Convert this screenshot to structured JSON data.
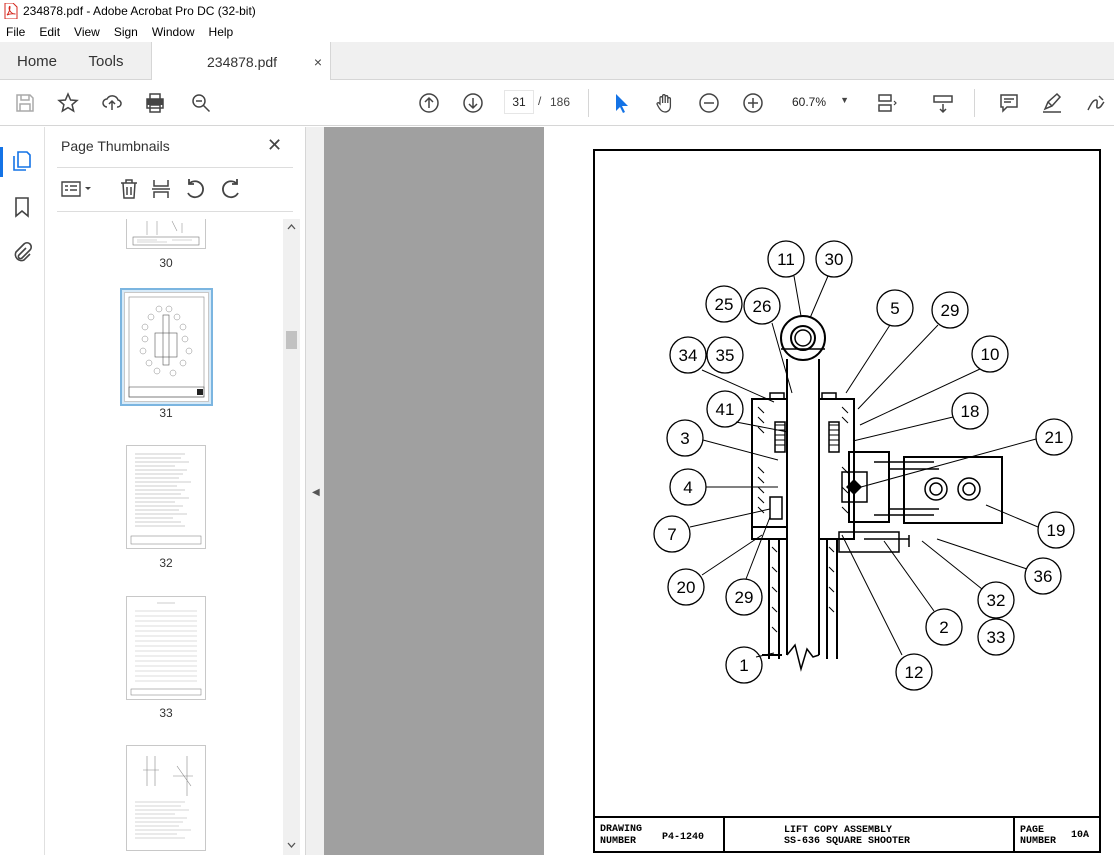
{
  "window": {
    "title": "234878.pdf - Adobe Acrobat Pro DC (32-bit)"
  },
  "menu": [
    "File",
    "Edit",
    "View",
    "Sign",
    "Window",
    "Help"
  ],
  "tabs": {
    "home": "Home",
    "tools": "Tools",
    "document": "234878.pdf",
    "close": "×"
  },
  "toolbar": {
    "current_page": "31",
    "page_separator": "/",
    "total_pages": "186",
    "zoom": "60.7%"
  },
  "thumbnail_panel": {
    "title": "Page Thumbnails",
    "close": "✕",
    "thumbnails": [
      {
        "label": "30"
      },
      {
        "label": "31",
        "selected": true
      },
      {
        "label": "32"
      },
      {
        "label": "33"
      }
    ]
  },
  "drawing": {
    "callouts": [
      "11",
      "30",
      "25",
      "26",
      "5",
      "29",
      "34",
      "35",
      "10",
      "41",
      "18",
      "3",
      "21",
      "4",
      "19",
      "7",
      "36",
      "20",
      "29",
      "32",
      "2",
      "33",
      "1",
      "12"
    ],
    "title_block": {
      "drawing_label_1": "DRAWING",
      "drawing_label_2": "NUMBER",
      "drawing_number": "P4-1240",
      "title_1": "LIFT COPY ASSEMBLY",
      "title_2": "SS-636 SQUARE SHOOTER",
      "page_label_1": "PAGE",
      "page_label_2": "NUMBER",
      "page_number": "10A"
    }
  },
  "colors": {
    "accent": "#1473e6",
    "canvas": "#a0a0a0"
  }
}
